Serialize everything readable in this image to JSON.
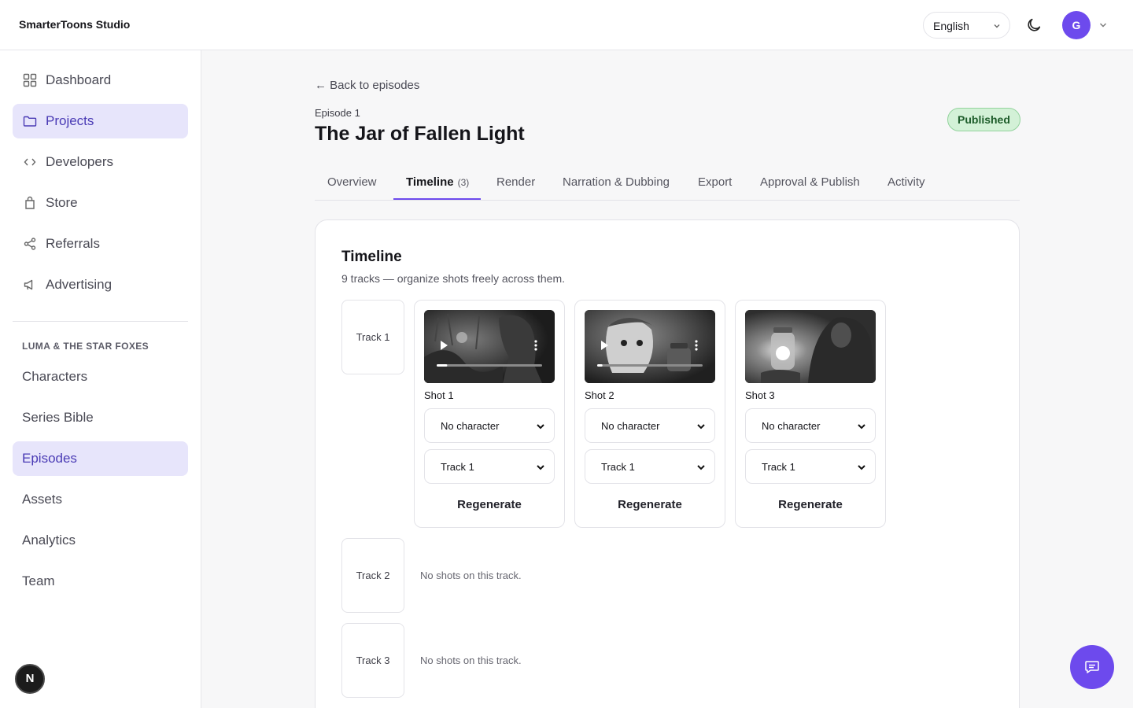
{
  "app": {
    "brand": "SmarterToons Studio"
  },
  "header": {
    "language": "English",
    "avatar_initial": "G"
  },
  "sidebar": {
    "items": [
      {
        "label": "Dashboard",
        "icon": "grid-icon"
      },
      {
        "label": "Projects",
        "icon": "folder-icon",
        "active": true
      },
      {
        "label": "Developers",
        "icon": "code-icon"
      },
      {
        "label": "Store",
        "icon": "bag-icon"
      },
      {
        "label": "Referrals",
        "icon": "share-icon"
      },
      {
        "label": "Advertising",
        "icon": "megaphone-icon"
      }
    ],
    "section_title": "LUMA & THE STAR FOXES",
    "sub_items": [
      {
        "label": "Characters"
      },
      {
        "label": "Series Bible"
      },
      {
        "label": "Episodes",
        "active": true
      },
      {
        "label": "Assets"
      },
      {
        "label": "Analytics"
      },
      {
        "label": "Team"
      }
    ],
    "badge": "N"
  },
  "episode": {
    "back_link": "← Back to episodes",
    "label": "Episode 1",
    "title": "The Jar of Fallen Light",
    "status": "Published"
  },
  "tabs": [
    {
      "label": "Overview"
    },
    {
      "label": "Timeline",
      "count": "(3)",
      "active": true
    },
    {
      "label": "Render"
    },
    {
      "label": "Narration & Dubbing"
    },
    {
      "label": "Export"
    },
    {
      "label": "Approval & Publish"
    },
    {
      "label": "Activity"
    }
  ],
  "timeline": {
    "title": "Timeline",
    "subtitle": "9 tracks — organize shots freely across them.",
    "tracks": [
      {
        "label": "Track 1"
      },
      {
        "label": "Track 2",
        "empty": "No shots on this track."
      },
      {
        "label": "Track 3",
        "empty": "No shots on this track."
      }
    ],
    "shots": [
      {
        "name": "Shot 1",
        "character": "No character",
        "track": "Track 1",
        "action": "Regenerate",
        "progress": 0.1
      },
      {
        "name": "Shot 2",
        "character": "No character",
        "track": "Track 1",
        "action": "Regenerate",
        "progress": 0.05
      },
      {
        "name": "Shot 3",
        "character": "No character",
        "track": "Track 1",
        "action": "Regenerate"
      }
    ]
  },
  "colors": {
    "accent": "#6d4aed",
    "published_bg": "#d3f1d7",
    "active_nav_bg": "#e7e5fb"
  }
}
